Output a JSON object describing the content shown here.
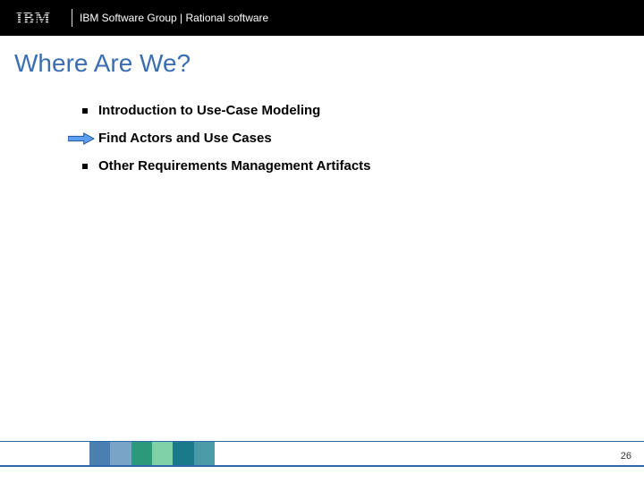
{
  "header": {
    "logo_text": "IBM",
    "text": "IBM Software Group | Rational software"
  },
  "title": "Where Are We?",
  "bullets": [
    {
      "text": "Introduction to Use-Case Modeling",
      "current": false
    },
    {
      "text": "Find Actors and Use Cases",
      "current": true
    },
    {
      "text": "Other Requirements Management Artifacts",
      "current": false
    }
  ],
  "page_number": "26"
}
